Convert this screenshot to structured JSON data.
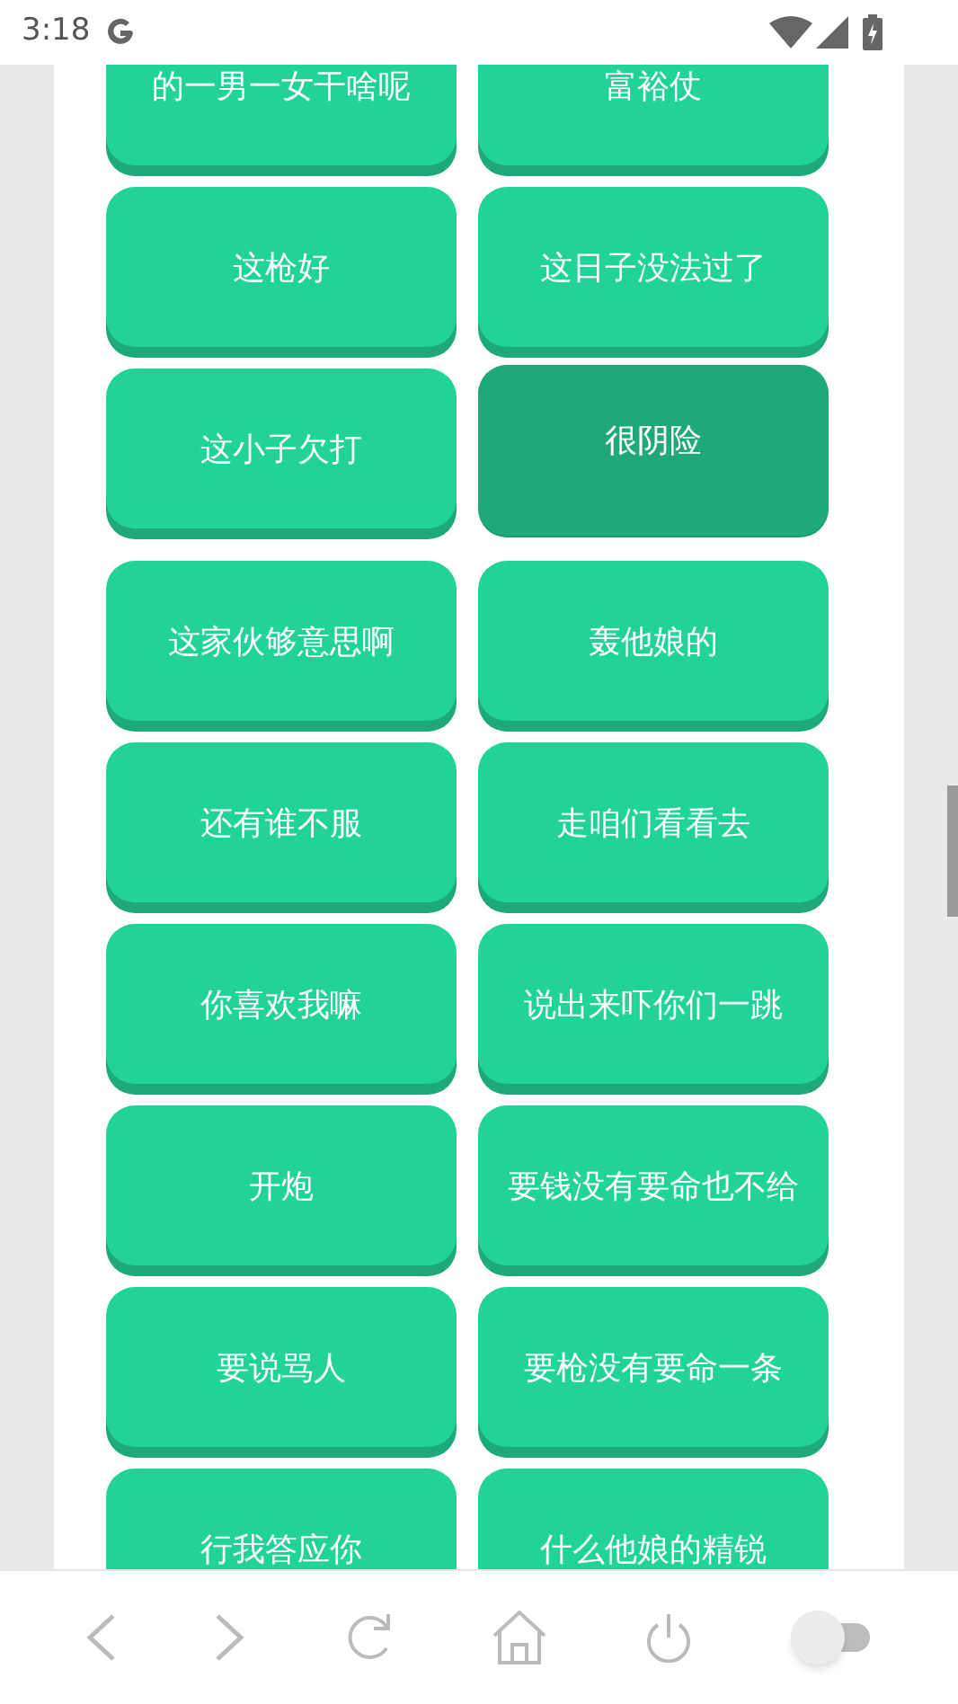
{
  "status_bar": {
    "time": "3:18"
  },
  "buttons": [
    {
      "label": "的一男一女干啥呢",
      "pressed": false
    },
    {
      "label": "富裕仗",
      "pressed": false
    },
    {
      "label": "这枪好",
      "pressed": false
    },
    {
      "label": "这日子没法过了",
      "pressed": false
    },
    {
      "label": "这小子欠打",
      "pressed": false
    },
    {
      "label": "很阴险",
      "pressed": true
    },
    {
      "label": "这家伙够意思啊",
      "pressed": false
    },
    {
      "label": "轰他娘的",
      "pressed": false
    },
    {
      "label": "还有谁不服",
      "pressed": false
    },
    {
      "label": "走咱们看看去",
      "pressed": false
    },
    {
      "label": "你喜欢我嘛",
      "pressed": false
    },
    {
      "label": "说出来吓你们一跳",
      "pressed": false
    },
    {
      "label": "开炮",
      "pressed": false
    },
    {
      "label": "要钱没有要命也不给",
      "pressed": false
    },
    {
      "label": "要说骂人",
      "pressed": false
    },
    {
      "label": "要枪没有要命一条",
      "pressed": false
    },
    {
      "label": "行我答应你",
      "pressed": false
    },
    {
      "label": "什么他娘的精锐",
      "pressed": false
    }
  ],
  "bottom_bar": {
    "toggle_on": false
  }
}
